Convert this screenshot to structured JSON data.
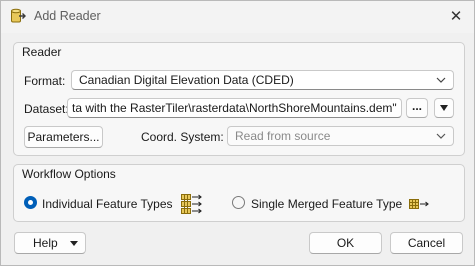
{
  "window": {
    "title": "Add Reader"
  },
  "reader_group": {
    "title": "Reader",
    "format_label": "Format:",
    "format_value": "Canadian Digital Elevation Data (CDED)",
    "dataset_label": "Dataset:",
    "dataset_value": "ta with the RasterTiler\\rasterdata\\NorthShoreMountains.dem\"",
    "browse_label": "...",
    "parameters_label": "Parameters...",
    "coord_label": "Coord. System:",
    "coord_value": "Read from source"
  },
  "workflow_group": {
    "title": "Workflow Options",
    "option_individual": "Individual Feature Types",
    "option_merged": "Single Merged Feature Type",
    "selected": "individual"
  },
  "footer": {
    "help_label": "Help",
    "ok_label": "OK",
    "cancel_label": "Cancel"
  },
  "colors": {
    "accent": "#005fb8",
    "icon_gold": "#c9a227"
  }
}
